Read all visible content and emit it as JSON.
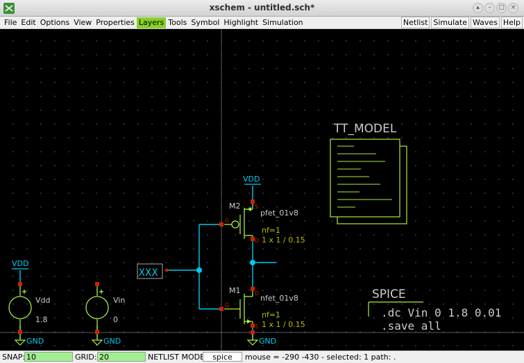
{
  "window": {
    "title": "xschem - untitled.sch*"
  },
  "menu": {
    "items": [
      "File",
      "Edit",
      "Options",
      "View",
      "Properties",
      "Layers",
      "Tools",
      "Symbol",
      "Highlight",
      "Simulation"
    ],
    "active": "Layers",
    "right_buttons": [
      "Netlist",
      "Simulate",
      "Waves",
      "Help"
    ]
  },
  "schematic": {
    "m2": {
      "name": "M2",
      "model": "pfet_01v8",
      "nf": "nf=1",
      "size": "1 x 1 / 0.15"
    },
    "m1": {
      "name": "M1",
      "model": "nfet_01v8",
      "nf": "nf=1",
      "size": "1 x 1 / 0.15"
    },
    "pins": {
      "g": "G",
      "s": "S",
      "d": "D"
    },
    "vdd_label": "VDD",
    "gnd_label": "GND",
    "vdd_source": {
      "name": "Vdd",
      "value": "1.8"
    },
    "vin_source": {
      "name": "Vin",
      "value": "0"
    },
    "input_label": "XXX",
    "model_block": "TT_MODEL",
    "spice_block": {
      "title": "SPICE",
      "line1": ".dc Vin 0 1.8 0.01",
      "line2": ".save all"
    },
    "colors": {
      "wire": "#00ccee",
      "symbol": "#aaee44",
      "pin": "#cc2200",
      "text": "#cccccc",
      "attr": "#bbbb00",
      "label": "#00ccee"
    }
  },
  "status": {
    "snap_label": "SNAP:",
    "snap_value": "10",
    "grid_label": "GRID:",
    "grid_value": "20",
    "netlist_label": "NETLIST MODE:",
    "netlist_value": "spice",
    "info": "mouse = -290 -430 - selected: 1 path: ."
  }
}
